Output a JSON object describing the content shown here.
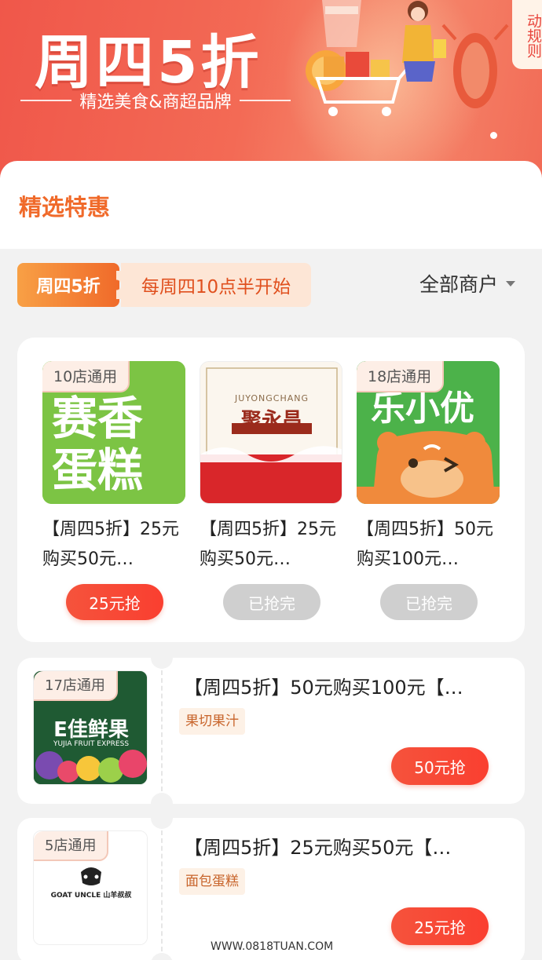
{
  "banner": {
    "title": "周四5折",
    "subtitle": "精选美食&商超品牌",
    "rules_label": "动规则"
  },
  "section": {
    "title": "精选特惠"
  },
  "filter": {
    "tag": "周四5折",
    "note": "每周四10点半开始",
    "merchant_label": "全部商户"
  },
  "grid_items": [
    {
      "tag": "10店通用",
      "name": "【周四5折】25元购买50元…",
      "button": "25元抢",
      "status": "active",
      "brand_text": "赛香蛋糕"
    },
    {
      "tag": "",
      "name": "【周四5折】25元购买50元…",
      "button": "已抢完",
      "status": "sold_out",
      "brand_text": "聚永昌",
      "brand_sub": "JUYONGCHANG"
    },
    {
      "tag": "18店通用",
      "name": "【周四5折】50元购买100元…",
      "button": "已抢完",
      "status": "sold_out",
      "brand_text": "乐小优"
    }
  ],
  "list_items": [
    {
      "tag": "17店通用",
      "name": "【周四5折】50元购买100元【…",
      "category": "果切果汁",
      "button": "50元抢",
      "brand_text": "E佳鲜果",
      "brand_sub": "YUJIA FRUIT EXPRESS"
    },
    {
      "tag": "5店通用",
      "name": "【周四5折】25元购买50元【…",
      "category": "面包蛋糕",
      "button": "25元抢",
      "brand_text": "GOAT UNCLE 山羊叔叔"
    }
  ],
  "watermark": "WWW.0818TUAN.COM",
  "colors": {
    "accent": "#f06a2a",
    "button_red": "#f5533c",
    "button_grey": "#cfcfcf"
  }
}
